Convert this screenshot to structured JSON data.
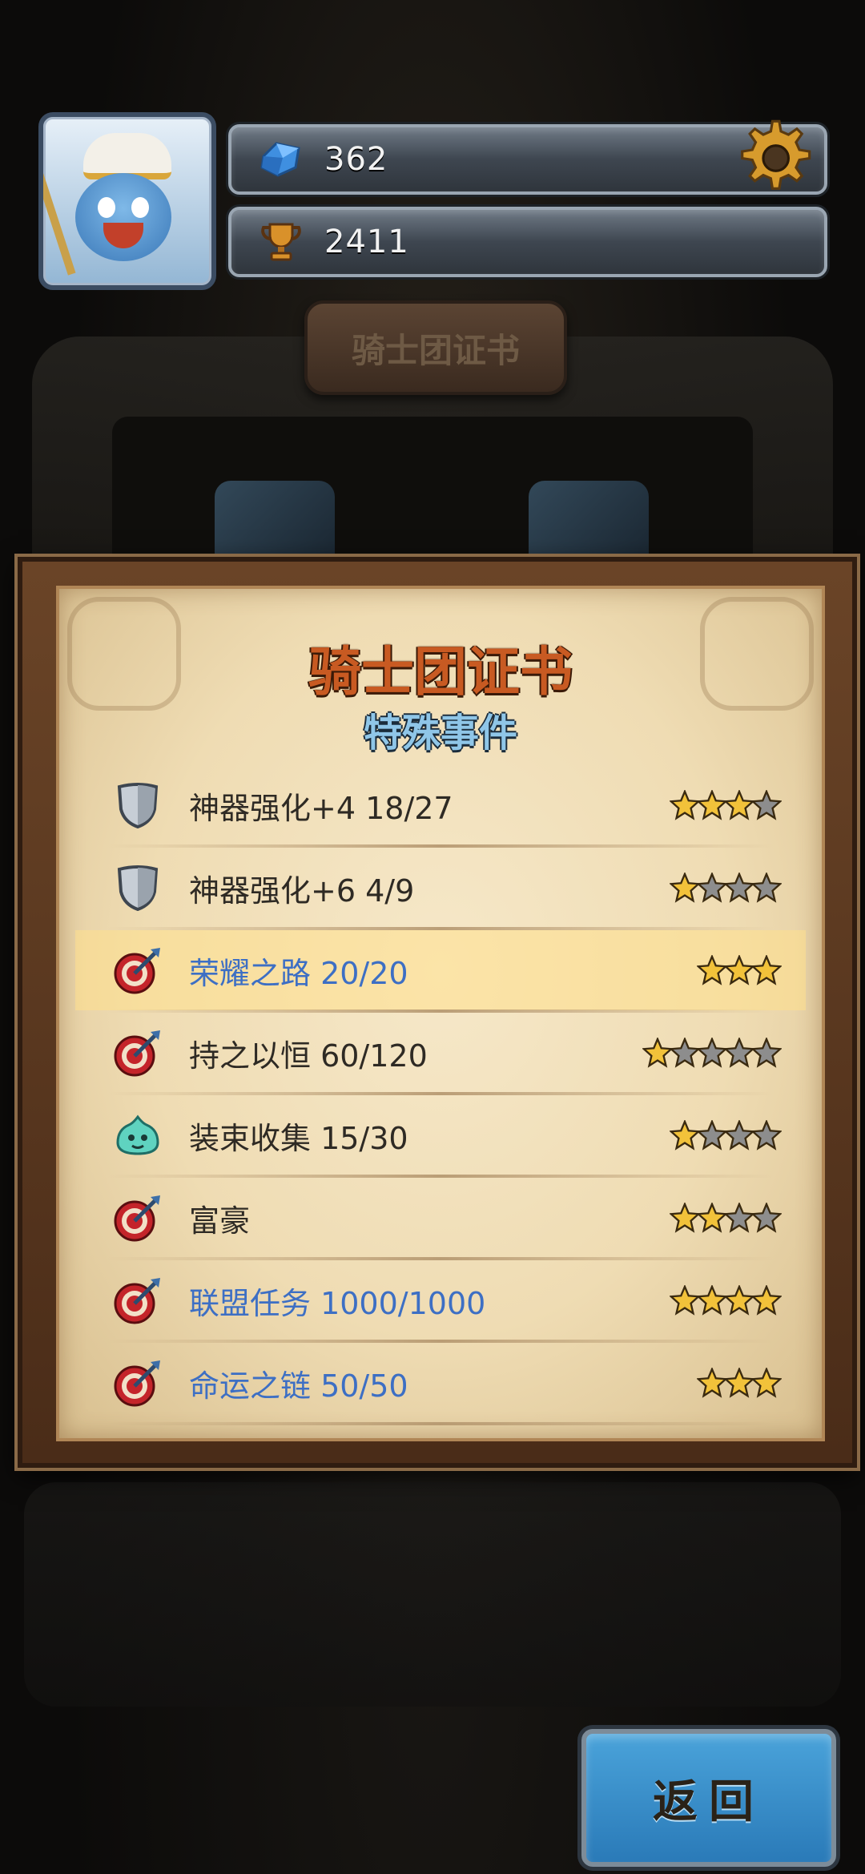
{
  "hud": {
    "gems": "362",
    "trophies": "2411"
  },
  "background": {
    "plaque_text": "骑士团证书"
  },
  "panel": {
    "title": "骑士团证书",
    "subtitle": "特殊事件",
    "rows": [
      {
        "label": "神器强化+4 18/27",
        "icon": "shield-icon",
        "filled_stars": 3,
        "total_stars": 4,
        "done": false
      },
      {
        "label": "神器强化+6 4/9",
        "icon": "shield-icon",
        "filled_stars": 1,
        "total_stars": 4,
        "done": false
      },
      {
        "label": "荣耀之路 20/20",
        "icon": "target-icon",
        "filled_stars": 3,
        "total_stars": 3,
        "done": true
      },
      {
        "label": "持之以恒 60/120",
        "icon": "target-icon",
        "filled_stars": 1,
        "total_stars": 5,
        "done": false
      },
      {
        "label": "装束收集 15/30",
        "icon": "slime-icon",
        "filled_stars": 1,
        "total_stars": 4,
        "done": false
      },
      {
        "label": "富豪",
        "icon": "target-icon",
        "filled_stars": 2,
        "total_stars": 4,
        "done": false
      },
      {
        "label": "联盟任务 1000/1000",
        "icon": "target-icon",
        "filled_stars": 4,
        "total_stars": 4,
        "done": true
      },
      {
        "label": "命运之链 50/50",
        "icon": "target-icon",
        "filled_stars": 3,
        "total_stars": 3,
        "done": true
      }
    ]
  },
  "buttons": {
    "back_label": "返回"
  },
  "colors": {
    "title": "#c85a22",
    "subtitle": "#8fc6e8",
    "done_text": "#3d6fc4",
    "star_filled": "#f2c23a",
    "star_empty": "#8d8d8d"
  }
}
